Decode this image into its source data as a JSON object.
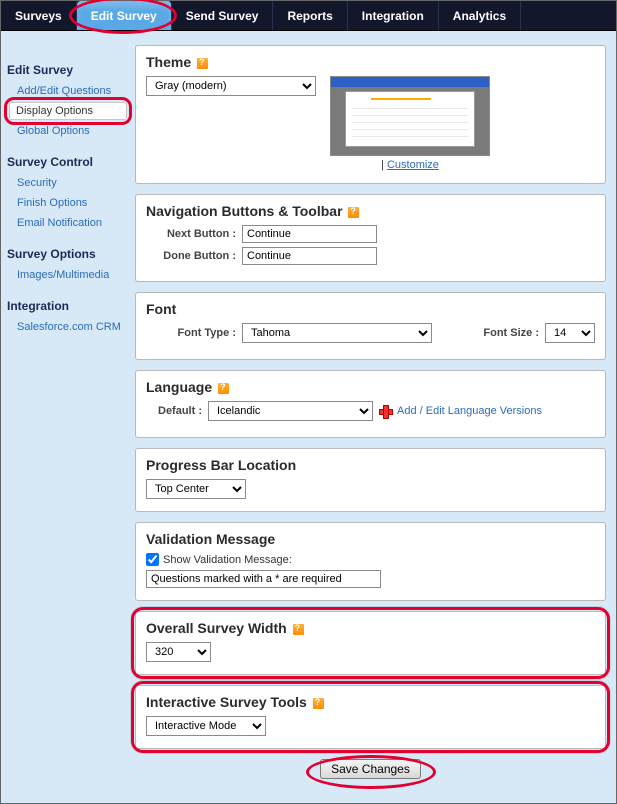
{
  "nav": {
    "tabs": [
      "Surveys",
      "Edit Survey",
      "Send Survey",
      "Reports",
      "Integration",
      "Analytics"
    ],
    "active_index": 1
  },
  "sidebar": {
    "sections": [
      {
        "title": "Edit Survey",
        "items": [
          "Add/Edit Questions",
          "Display Options",
          "Global Options"
        ],
        "selected_index": 1
      },
      {
        "title": "Survey Control",
        "items": [
          "Security",
          "Finish Options",
          "Email Notification"
        ]
      },
      {
        "title": "Survey Options",
        "items": [
          "Images/Multimedia"
        ]
      },
      {
        "title": "Integration",
        "items": [
          "Salesforce.com CRM"
        ]
      }
    ]
  },
  "panels": {
    "theme": {
      "title": "Theme",
      "select_value": "Gray (modern)",
      "customize_label": "Customize"
    },
    "nav_toolbar": {
      "title": "Navigation Buttons & Toolbar",
      "next_label": "Next Button :",
      "next_value": "Continue",
      "done_label": "Done Button :",
      "done_value": "Continue"
    },
    "font": {
      "title": "Font",
      "type_label": "Font Type :",
      "type_value": "Tahoma",
      "size_label": "Font Size :",
      "size_value": "14"
    },
    "language": {
      "title": "Language",
      "default_label": "Default :",
      "default_value": "Icelandic",
      "addedit_label": "Add / Edit Language Versions"
    },
    "progress": {
      "title": "Progress Bar Location",
      "value": "Top Center"
    },
    "validation": {
      "title": "Validation Message",
      "check_label": "Show Validation Message:",
      "checked": true,
      "text_value": "Questions marked with a * are required"
    },
    "width": {
      "title": "Overall Survey Width",
      "value": "320"
    },
    "interactive": {
      "title": "Interactive Survey Tools",
      "value": "Interactive Mode"
    }
  },
  "buttons": {
    "save": "Save Changes"
  }
}
